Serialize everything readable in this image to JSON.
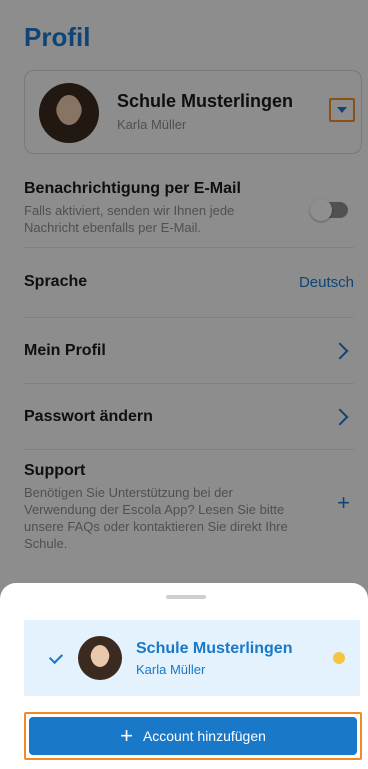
{
  "page": {
    "title": "Profil"
  },
  "account_card": {
    "school": "Schule Musterlingen",
    "user": "Karla Müller"
  },
  "settings": {
    "email_notification": {
      "title": "Benachrichtigung per E-Mail",
      "description": "Falls aktiviert, senden wir Ihnen jede Nachricht ebenfalls per E-Mail.",
      "enabled": false
    },
    "language": {
      "title": "Sprache",
      "value": "Deutsch"
    },
    "my_profile": {
      "title": "Mein Profil"
    },
    "change_password": {
      "title": "Passwort ändern"
    },
    "support": {
      "title": "Support",
      "description": "Benötigen Sie Unterstützung bei der Verwendung der Escola App? Lesen Sie bitte unsere FAQs oder kontaktieren Sie direkt Ihre Schule."
    }
  },
  "sheet": {
    "accounts": [
      {
        "school": "Schule Musterlingen",
        "user": "Karla Müller",
        "selected": true,
        "status_color": "#f4c542"
      }
    ],
    "add_account_label": "Account hinzufügen"
  },
  "icons": {
    "dropdown": "chevron-down-icon",
    "toggle": "toggle-switch",
    "chevron": "chevron-right-icon",
    "plus": "plus-icon",
    "check": "check-icon"
  },
  "colors": {
    "accent": "#1a78c8",
    "highlight_border": "#f08a24",
    "selected_bg": "#e3f2fc",
    "status": "#f4c542"
  }
}
